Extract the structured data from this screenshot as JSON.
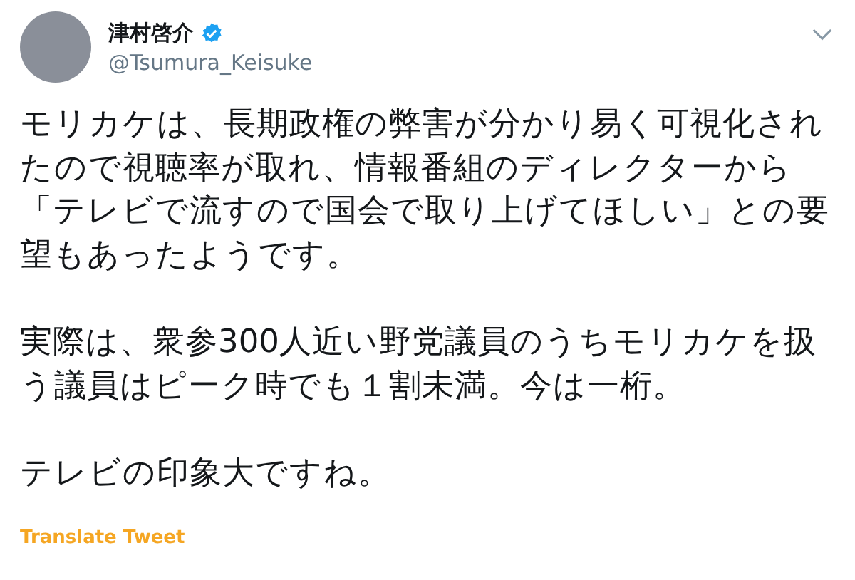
{
  "author": {
    "name": "津村啓介",
    "verified": true,
    "handle": "@Tsumura_Keisuke"
  },
  "paragraphs": [
    "モリカケは、長期政権の弊害が分かり易く可視化されたので視聴率が取れ、情報番組のディレクターから「テレビで流すので国会で取り上げてほしい」との要望もあったようです。",
    "実際は、衆参300人近い野党議員のうちモリカケを扱う議員はピーク時でも１割未満。今は一桁。",
    "テレビの印象大ですね。"
  ],
  "translate_link": "Translate Tweet"
}
